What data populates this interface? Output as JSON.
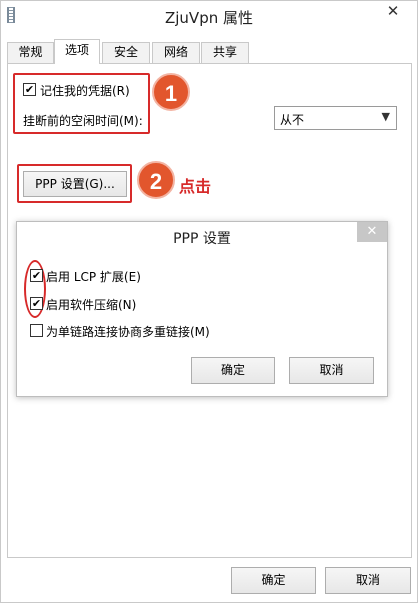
{
  "window": {
    "title": "ZjuVpn 属性",
    "close_glyph": "✕",
    "icon": "app-icon"
  },
  "tabs": [
    {
      "label": "常规",
      "active": false
    },
    {
      "label": "选项",
      "active": true
    },
    {
      "label": "安全",
      "active": false
    },
    {
      "label": "网络",
      "active": false
    },
    {
      "label": "共享",
      "active": false
    }
  ],
  "options": {
    "remember_credentials": {
      "label": "记住我的凭据(R)",
      "checked": true
    },
    "idle_time_label": "挂断前的空闲时间(M):",
    "idle_time_value": "从不",
    "ppp_button_label": "PPP 设置(G)..."
  },
  "annotations": {
    "badge1": "1",
    "badge2": "2",
    "click_text": "点击",
    "accent_color": "#d72a2a",
    "badge_color": "#e2562d"
  },
  "dialog": {
    "title": "PPP 设置",
    "close_glyph": "✕",
    "checkboxes": [
      {
        "label": "启用 LCP 扩展(E)",
        "checked": true
      },
      {
        "label": "启用软件压缩(N)",
        "checked": true
      },
      {
        "label": "为单链路连接协商多重链接(M)",
        "checked": false
      }
    ],
    "ok_label": "确定",
    "cancel_label": "取消"
  },
  "footer": {
    "ok_label": "确定",
    "cancel_label": "取消"
  }
}
